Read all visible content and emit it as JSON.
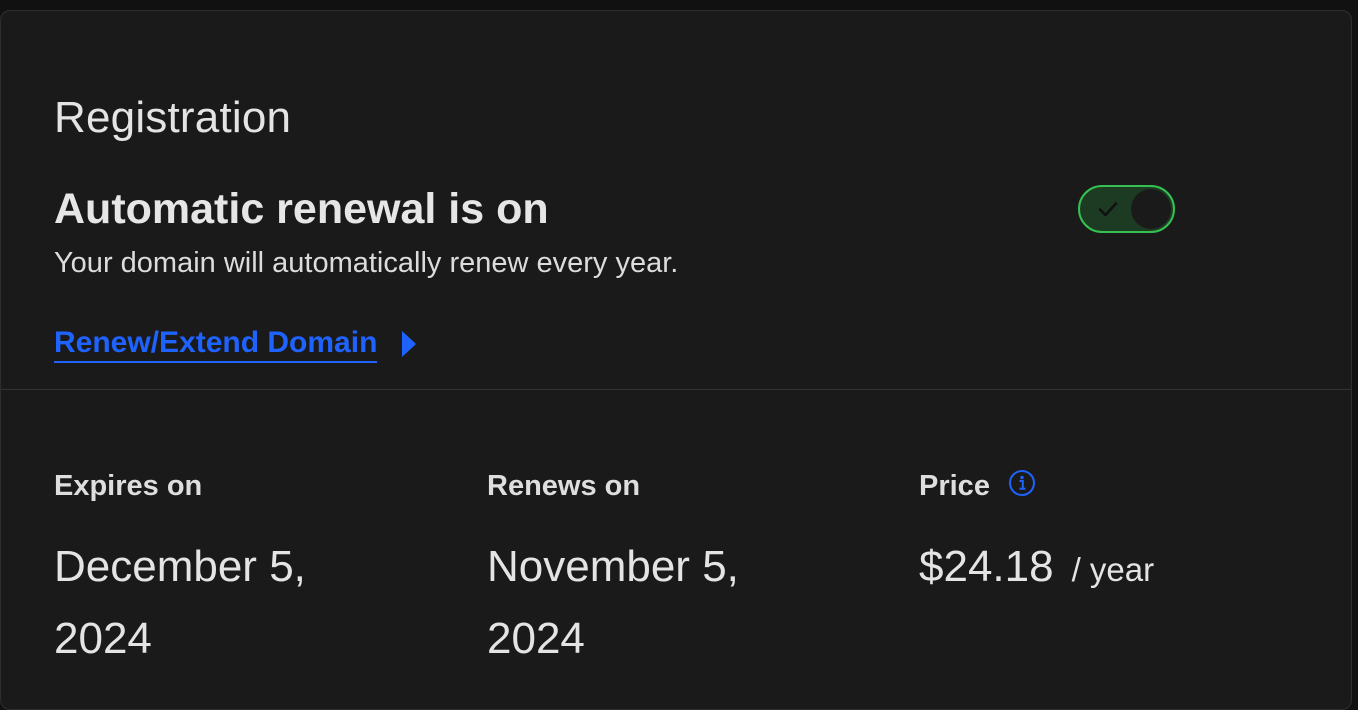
{
  "registration": {
    "title": "Registration",
    "renewal_heading": "Automatic renewal is on",
    "renewal_description": "Your domain will automatically renew every year.",
    "auto_renew_enabled": true,
    "renew_link_label": "Renew/Extend Domain"
  },
  "details": {
    "expires_label": "Expires on",
    "expires_value": "December 5, 2024",
    "renews_label": "Renews on",
    "renews_value": "November 5, 2024",
    "price_label": "Price",
    "price_value": "$24.18",
    "price_unit": "/ year"
  },
  "colors": {
    "background": "#1a1a1a",
    "link": "#1f63ff",
    "toggle_on": "#35c152"
  },
  "icons": {
    "toggle": "checkmark-icon",
    "link_arrow": "caret-right-icon",
    "price_info": "info-circle-icon"
  }
}
